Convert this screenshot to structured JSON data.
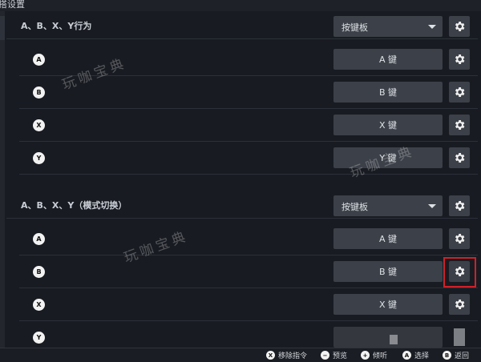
{
  "page_title": "搭设置",
  "watermark": "玩咖宝典",
  "sections": [
    {
      "title": "A、B、X、Y行为",
      "mode": "按键板",
      "rows": [
        {
          "button": "A",
          "binding": "A 键"
        },
        {
          "button": "B",
          "binding": "B 键"
        },
        {
          "button": "X",
          "binding": "X 键"
        },
        {
          "button": "Y",
          "binding": "Y 键"
        }
      ]
    },
    {
      "title": "A、B、X、Y（模式切换）",
      "mode": "按键板",
      "rows": [
        {
          "button": "A",
          "binding": "A 键"
        },
        {
          "button": "B",
          "binding": "B 键"
        },
        {
          "button": "X",
          "binding": "X 键"
        },
        {
          "button": "Y",
          "binding": ""
        }
      ]
    }
  ],
  "footer": [
    {
      "key": "X",
      "label": "移除指令"
    },
    {
      "key": "−",
      "label": "预览"
    },
    {
      "key": "+",
      "label": "倾听"
    },
    {
      "key": "A",
      "label": "选择"
    },
    {
      "key": "B",
      "label": "返回"
    }
  ],
  "colors": {
    "highlight": "#d0202a",
    "background": "#181b21",
    "control": "#3c4048"
  },
  "icons": {
    "settings": "gear-icon",
    "dropdown": "chevron-down-icon"
  }
}
